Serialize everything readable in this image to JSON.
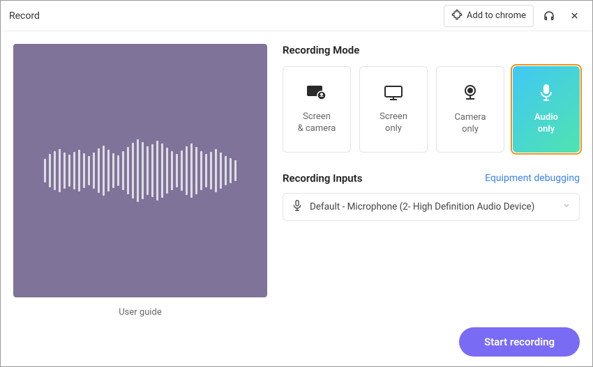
{
  "titlebar": {
    "title": "Record",
    "add_to_chrome": "Add to chrome"
  },
  "preview": {
    "user_guide": "User guide"
  },
  "mode_section": {
    "title": "Recording Mode",
    "options": [
      {
        "line1": "Screen",
        "line2": "& camera"
      },
      {
        "line1": "Screen",
        "line2": "only"
      },
      {
        "line1": "Camera",
        "line2": "only"
      },
      {
        "line1": "Audio",
        "line2": "only"
      }
    ],
    "selected_index": 3
  },
  "inputs_section": {
    "title": "Recording Inputs",
    "debug_link": "Equipment debugging",
    "mic_value": "Default - Microphone (2- High Definition Audio Device)"
  },
  "footer": {
    "start": "Start recording"
  },
  "colors": {
    "accent": "#7a6bf5",
    "highlight": "#f0941f",
    "preview_bg": "#7f7399",
    "link": "#3b82f6"
  }
}
